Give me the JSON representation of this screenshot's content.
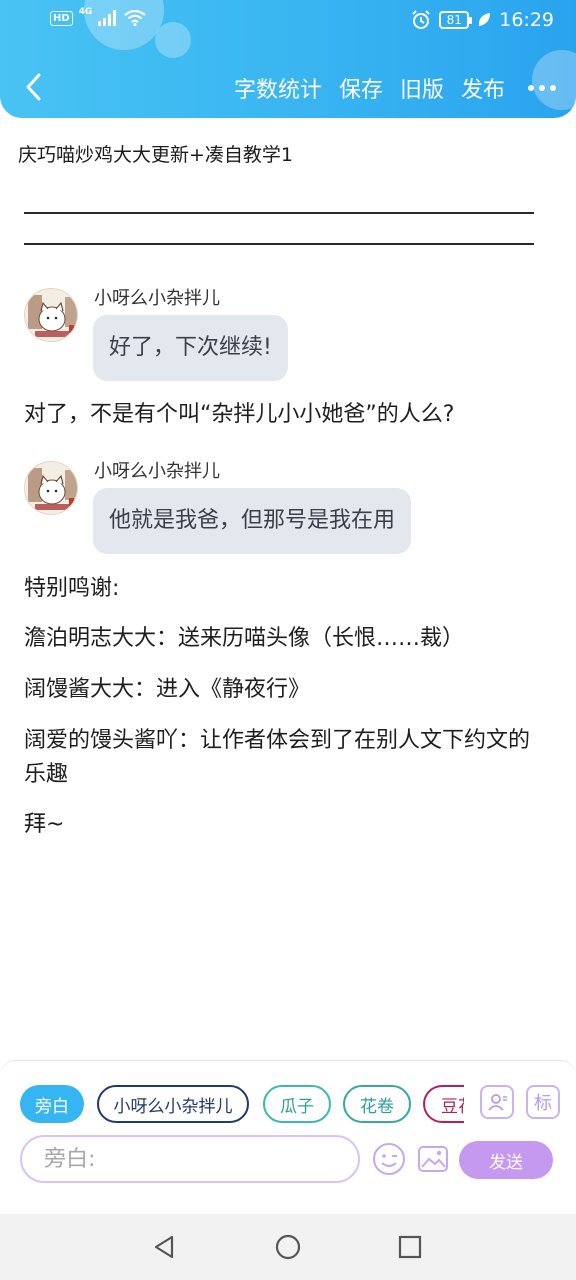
{
  "status_bar": {
    "network_tag": "HD",
    "network_type": "4G",
    "battery": "81",
    "time": "16:29"
  },
  "header": {
    "actions": [
      "字数统计",
      "保存",
      "旧版",
      "发布"
    ]
  },
  "document": {
    "title": "庆巧喵炒鸡大大更新+凑自教学1",
    "divider_line_1": "————————————————————————",
    "divider_line_2": "————————————————————————"
  },
  "messages": [
    {
      "speaker": "小呀么小杂拌儿",
      "text": "好了，下次继续!"
    },
    {
      "speaker": "小呀么小杂拌儿",
      "text": "他就是我爸，但那号是我在用"
    }
  ],
  "paragraphs": [
    "对了，不是有个叫“杂拌儿小小她爸”的人么?",
    "特别鸣谢:",
    "澹泊明志大大：送来历喵头像（长恨……裁）",
    "阔馒酱大大：进入《静夜行》",
    "阔爱的馒头酱吖：让作者体会到了在别人文下约文的乐趣",
    "拜~"
  ],
  "composer": {
    "roles": [
      "旁白",
      "小呀么小杂拌儿",
      "瓜子",
      "花卷",
      "豆花"
    ],
    "mark_button": "标",
    "input_placeholder": "旁白:",
    "send_label": "发送"
  },
  "colors": {
    "header_blue": "#38b4f1",
    "active_chip": "#35b6f2",
    "send_button": "#c699f1",
    "bubble_bg": "#e3e8ef"
  }
}
